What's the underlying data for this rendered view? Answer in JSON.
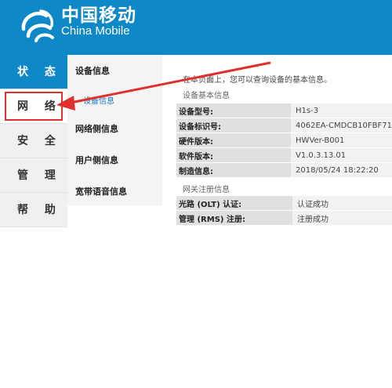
{
  "brand": {
    "cn": "中国移动",
    "en": "China Mobile"
  },
  "nav": [
    {
      "label": "状 态"
    },
    {
      "label": "网 络"
    },
    {
      "label": "安 全"
    },
    {
      "label": "管 理"
    },
    {
      "label": "帮 助"
    }
  ],
  "subnav": {
    "items": [
      "设备信息",
      "网络侧信息",
      "用户侧信息",
      "宽带语音信息"
    ],
    "selected": "设备信息"
  },
  "content": {
    "description": "在本页面上，您可以查询设备的基本信息。",
    "basic_title": "设备基本信息",
    "basic": [
      {
        "key": "设备型号:",
        "value": "H1s-3"
      },
      {
        "key": "设备标识号:",
        "value": "4062EA-CMDCB10FBF71"
      },
      {
        "key": "硬件版本:",
        "value": "HWVer-B001"
      },
      {
        "key": "软件版本:",
        "value": "V1.0.3.13.01"
      },
      {
        "key": "制造信息:",
        "value": "2018/05/24 18:22:20"
      }
    ],
    "reg_title": "网关注册信息",
    "reg": [
      {
        "key": "光路 (OLT) 认证:",
        "value": "认证成功"
      },
      {
        "key": "管理 (RMS) 注册:",
        "value": "注册成功"
      }
    ]
  },
  "colors": {
    "brand_blue": "#0e88c6",
    "highlight_red": "#e0302e"
  }
}
